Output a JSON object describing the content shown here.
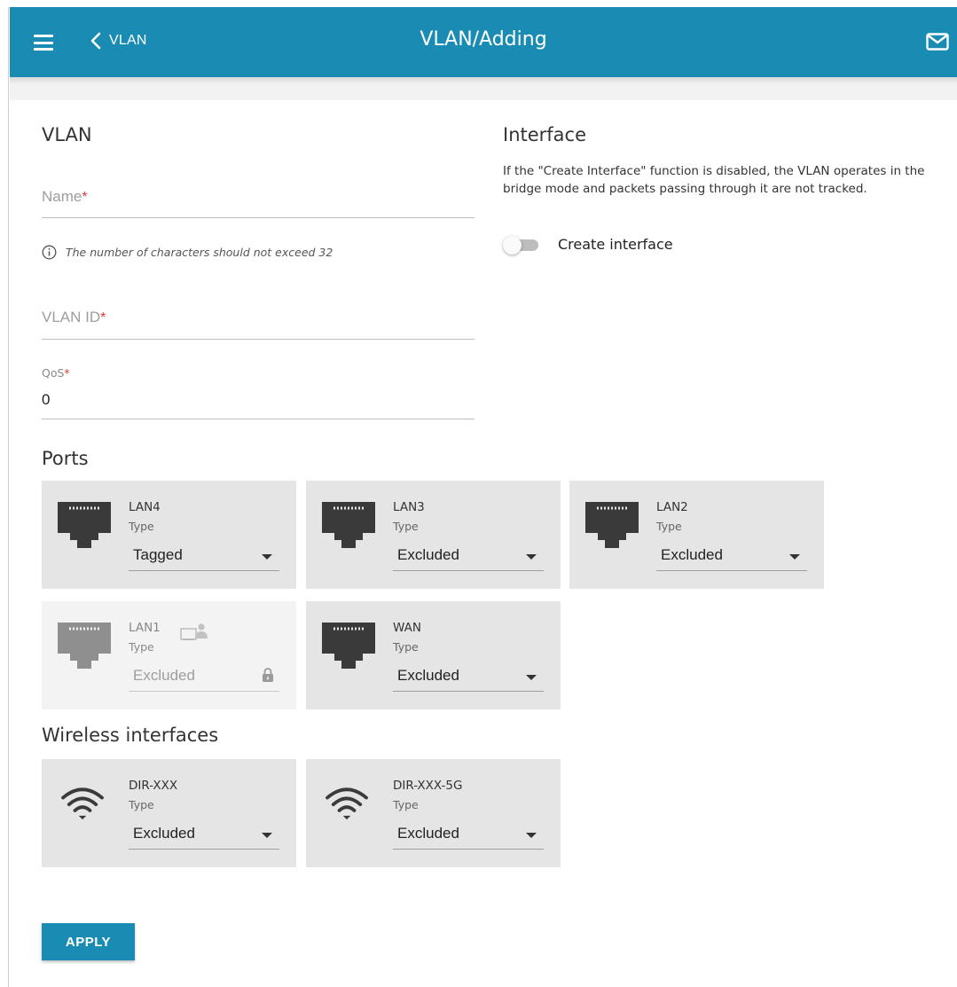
{
  "header": {
    "back_label": "VLAN",
    "title": "VLAN/Adding",
    "accent_color": "#1a8cb3"
  },
  "vlan_section": {
    "title": "VLAN",
    "name_placeholder": "Name",
    "name_hint": "The number of characters should not exceed 32",
    "vlan_id_placeholder": "VLAN ID",
    "qos_label": "QoS",
    "qos_value": "0",
    "required_mark": "*"
  },
  "interface_section": {
    "title": "Interface",
    "description": "If the \"Create Interface\" function is disabled, the VLAN operates in the bridge mode and packets passing through it are not tracked.",
    "create_interface_label": "Create interface",
    "create_interface_enabled": false
  },
  "ports": {
    "title": "Ports",
    "type_label": "Type",
    "items": [
      {
        "name": "LAN4",
        "type": "Tagged",
        "locked": false
      },
      {
        "name": "LAN3",
        "type": "Excluded",
        "locked": false
      },
      {
        "name": "LAN2",
        "type": "Excluded",
        "locked": false
      },
      {
        "name": "LAN1",
        "type": "Excluded",
        "locked": true
      },
      {
        "name": "WAN",
        "type": "Excluded",
        "locked": false
      }
    ]
  },
  "wireless": {
    "title": "Wireless interfaces",
    "type_label": "Type",
    "items": [
      {
        "name": "DIR-XXX",
        "type": "Excluded"
      },
      {
        "name": "DIR-XXX-5G",
        "type": "Excluded"
      }
    ]
  },
  "actions": {
    "apply_label": "APPLY"
  },
  "icons": [
    "menu-icon",
    "chevron-left-icon",
    "mail-icon",
    "info-icon",
    "ethernet-port-icon",
    "admin-user-icon",
    "lock-icon",
    "wifi-icon",
    "caret-down-icon"
  ]
}
